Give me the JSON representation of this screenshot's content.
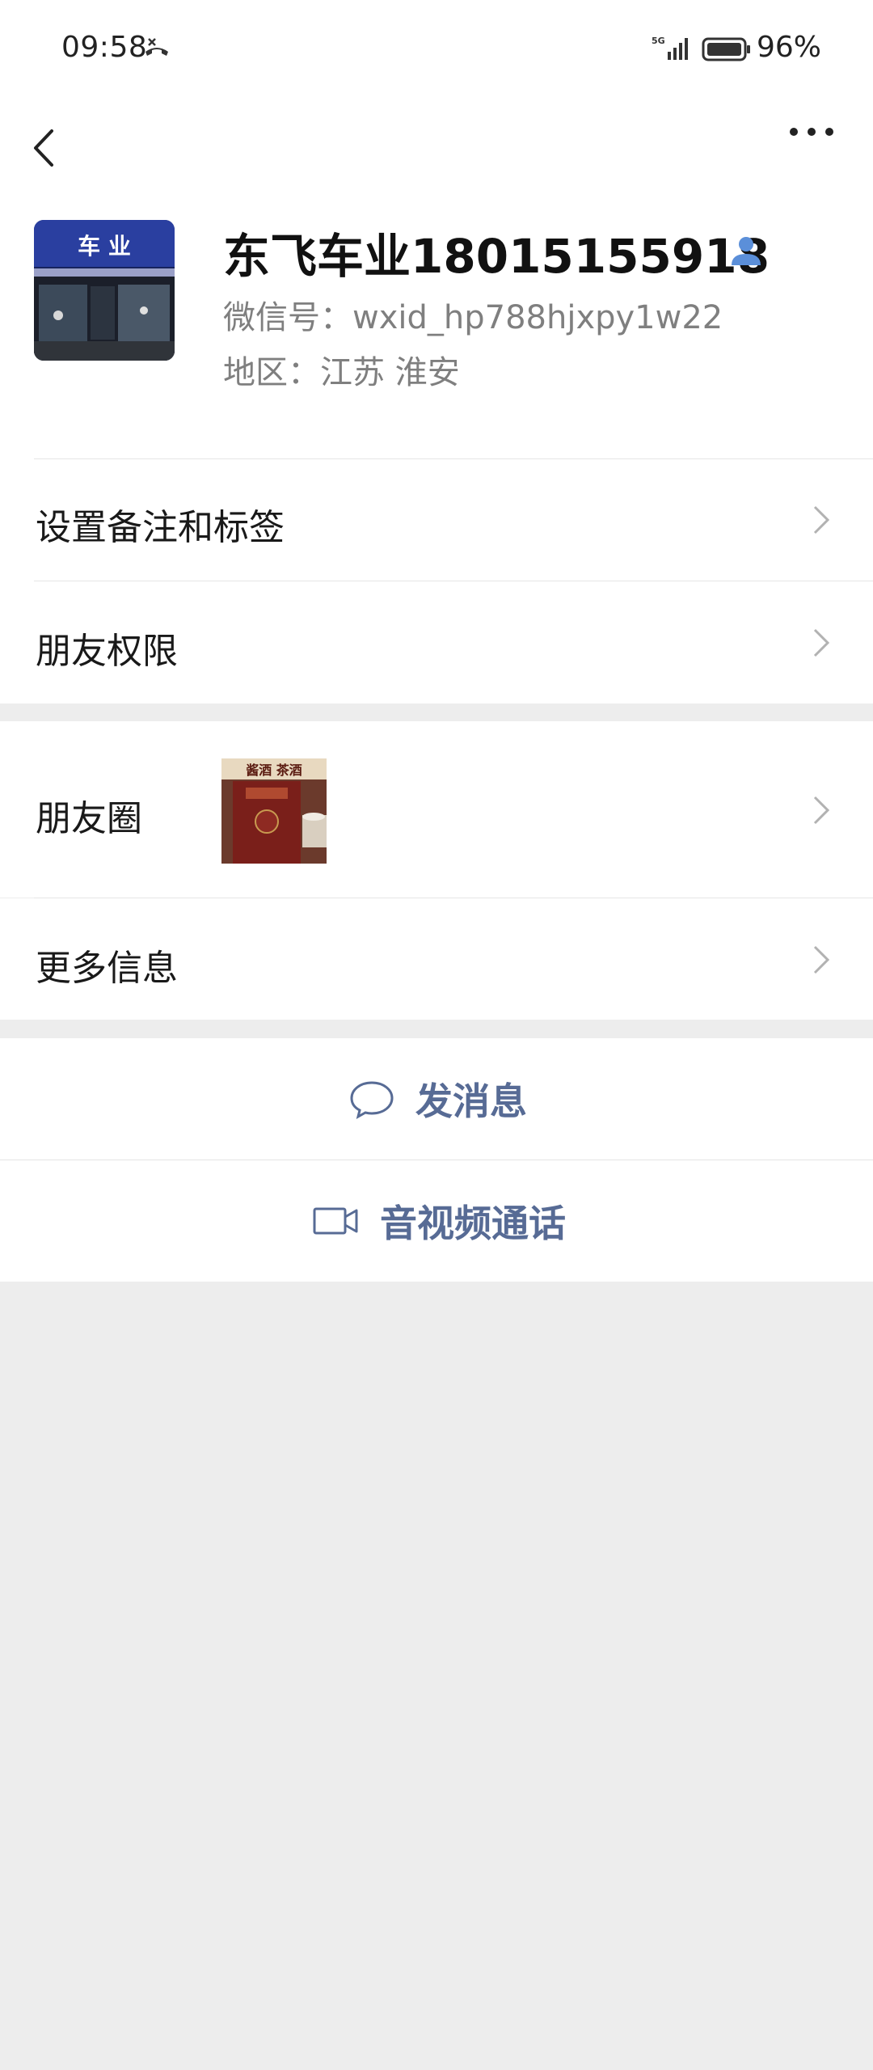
{
  "status_bar": {
    "time": "09:58",
    "network": "5G",
    "battery": "96%"
  },
  "profile": {
    "name": "东飞车业18015155918",
    "wechat_id": "微信号：wxid_hp788hjxpy1w22",
    "region": "地区：江苏  淮安",
    "avatar_sign_text": "车 业"
  },
  "rows": {
    "remark_tags": "设置备注和标签",
    "friend_permissions": "朋友权限",
    "moments": "朋友圈",
    "more_info": "更多信息"
  },
  "moments_thumb_text": "酱酒 茶酒",
  "actions": {
    "send_message": "发消息",
    "video_call": "音视频通话"
  },
  "colors": {
    "link_blue": "#576b95",
    "background": "#ededed",
    "person_icon_blue": "#5b8fd9"
  }
}
